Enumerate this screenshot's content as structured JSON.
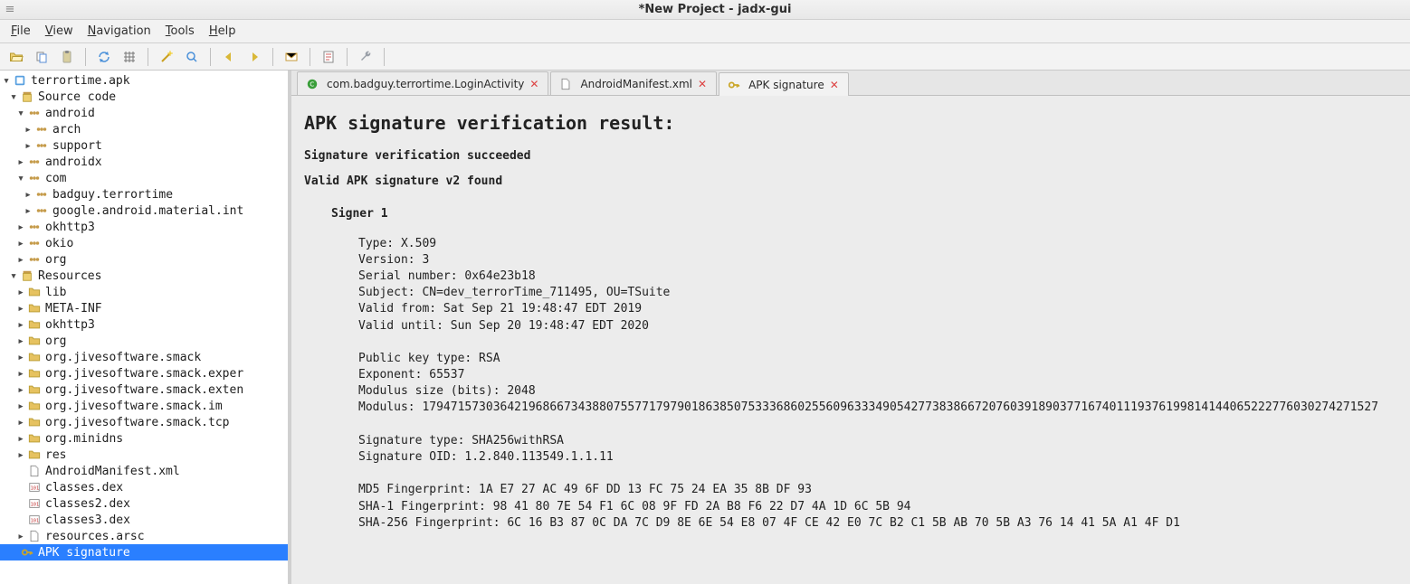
{
  "window": {
    "title": "*New Project - jadx-gui"
  },
  "menubar": [
    {
      "label": "File",
      "accel": "F"
    },
    {
      "label": "View",
      "accel": "V"
    },
    {
      "label": "Navigation",
      "accel": "N"
    },
    {
      "label": "Tools",
      "accel": "T"
    },
    {
      "label": "Help",
      "accel": "H"
    }
  ],
  "tree": {
    "root": "terrortime.apk",
    "source_code": "Source code",
    "android": "android",
    "arch": "arch",
    "support": "support",
    "androidx": "androidx",
    "com": "com",
    "badguy": "badguy.terrortime",
    "gmaterial": "google.android.material.int",
    "okhttp3": "okhttp3",
    "okio": "okio",
    "org": "org",
    "resources": "Resources",
    "lib": "lib",
    "metainf": "META-INF",
    "r_okhttp3": "okhttp3",
    "r_org": "org",
    "smack": "org.jivesoftware.smack",
    "smack_exper": "org.jivesoftware.smack.exper",
    "smack_exten": "org.jivesoftware.smack.exten",
    "smack_im": "org.jivesoftware.smack.im",
    "smack_tcp": "org.jivesoftware.smack.tcp",
    "minidns": "org.minidns",
    "res": "res",
    "manifest": "AndroidManifest.xml",
    "classes": "classes.dex",
    "classes2": "classes2.dex",
    "classes3": "classes3.dex",
    "resources_arsc": "resources.arsc",
    "apk_sig": "APK signature"
  },
  "tabs": [
    {
      "label": "com.badguy.terrortime.LoginActivity",
      "icon": "java"
    },
    {
      "label": "AndroidManifest.xml",
      "icon": "file"
    },
    {
      "label": "APK signature",
      "icon": "key"
    }
  ],
  "content": {
    "heading": "APK signature verification result:",
    "line1": "Signature verification succeeded",
    "line2": "Valid APK signature v2 found",
    "signer": "Signer 1",
    "details": "Type: X.509\nVersion: 3\nSerial number: 0x64e23b18\nSubject: CN=dev_terrorTime_711495, OU=TSuite\nValid from: Sat Sep 21 19:48:47 EDT 2019\nValid until: Sun Sep 20 19:48:47 EDT 2020\n\nPublic key type: RSA\nExponent: 65537\nModulus size (bits): 2048\nModulus: 179471573036421968667343880755771797901863850753336860255609633349054277383866720760391890377167401119376199814144065222776030274271527\n\nSignature type: SHA256withRSA\nSignature OID: 1.2.840.113549.1.1.11\n\nMD5 Fingerprint: 1A E7 27 AC 49 6F DD 13 FC 75 24 EA 35 8B DF 93\nSHA-1 Fingerprint: 98 41 80 7E 54 F1 6C 08 9F FD 2A B8 F6 22 D7 4A 1D 6C 5B 94\nSHA-256 Fingerprint: 6C 16 B3 87 0C DA 7C D9 8E 6E 54 E8 07 4F CE 42 E0 7C B2 C1 5B AB 70 5B A3 76 14 41 5A A1 4F D1"
  }
}
